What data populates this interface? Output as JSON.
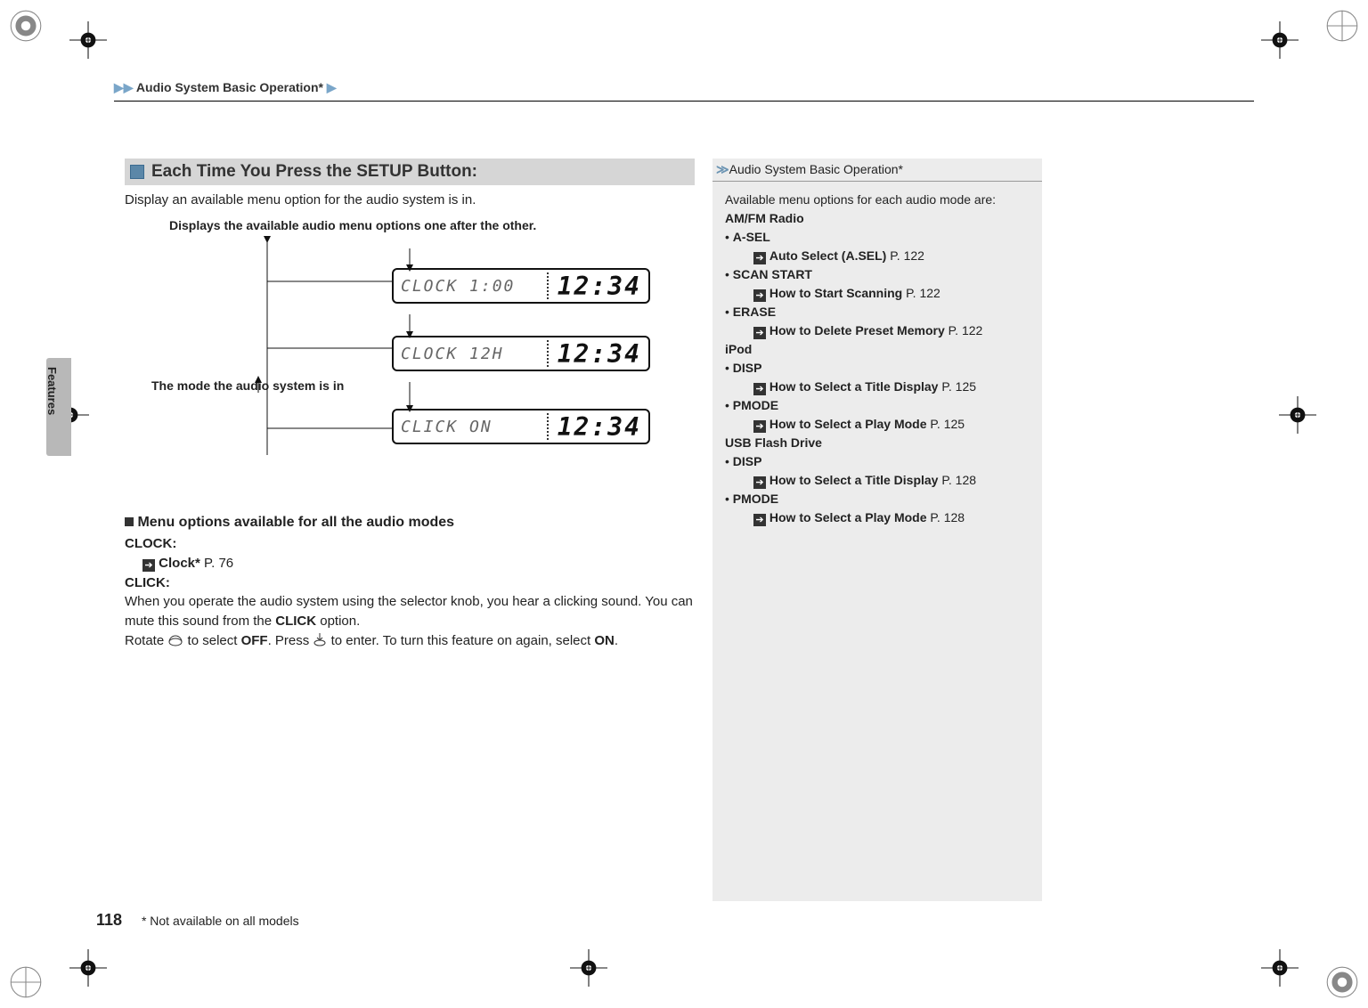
{
  "header": {
    "breadcrumb_prefix": "▶▶",
    "breadcrumb": "Audio System Basic Operation*",
    "breadcrumb_suffix": "▶"
  },
  "tab": {
    "label": "Features"
  },
  "main": {
    "heading": "Each Time You Press the SETUP Button:",
    "subtitle": "Display an available menu option for the audio system is in.",
    "diagram": {
      "caption_top": "Displays the available audio menu options one after the other.",
      "caption_mid": "The mode the audio system is in",
      "rows": [
        {
          "left": "CLOCK   1:00",
          "right": "12:34"
        },
        {
          "left": "CLOCK  12H",
          "right": "12:34"
        },
        {
          "left": "CLICK ON",
          "right": "12:34"
        }
      ]
    },
    "menu_section": {
      "heading": "Menu options available for all the audio modes",
      "clock_label": "CLOCK:",
      "clock_link_label": "Clock*",
      "clock_link_page": "P. 76",
      "click_label": "CLICK:",
      "click_para1": "When you operate the audio system using the selector knob, you hear a clicking sound. You can mute this sound from the ",
      "click_bold": "CLICK",
      "click_para1_tail": " option.",
      "click_para2_a": "Rotate ",
      "click_para2_b": " to select ",
      "click_off": "OFF",
      "click_para2_c": ". Press ",
      "click_para2_d": " to enter. To turn this feature on again, select ",
      "click_on": "ON",
      "click_para2_e": "."
    }
  },
  "sidebar": {
    "title": "Audio System Basic Operation*",
    "intro": "Available menu options for each audio mode are:",
    "groups": [
      {
        "heading": "AM/FM Radio",
        "items": [
          {
            "label": "A-SEL",
            "link": "Auto Select (A.SEL)",
            "page": "P. 122"
          },
          {
            "label": "SCAN START",
            "link": "How to Start Scanning",
            "page": "P. 122"
          },
          {
            "label": "ERASE",
            "link": "How to Delete Preset Memory",
            "page": "P. 122"
          }
        ]
      },
      {
        "heading": "iPod",
        "items": [
          {
            "label": "DISP",
            "link": "How to Select a Title Display",
            "page": "P. 125"
          },
          {
            "label": "PMODE",
            "link": "How to Select a Play Mode",
            "page": "P. 125"
          }
        ]
      },
      {
        "heading": "USB Flash Drive",
        "items": [
          {
            "label": "DISP",
            "link": "How to Select a Title Display",
            "page": "P. 128"
          },
          {
            "label": "PMODE",
            "link": "How to Select a Play Mode",
            "page": "P. 128"
          }
        ]
      }
    ]
  },
  "footer": {
    "page_number": "118",
    "footnote": "* Not available on all models"
  }
}
